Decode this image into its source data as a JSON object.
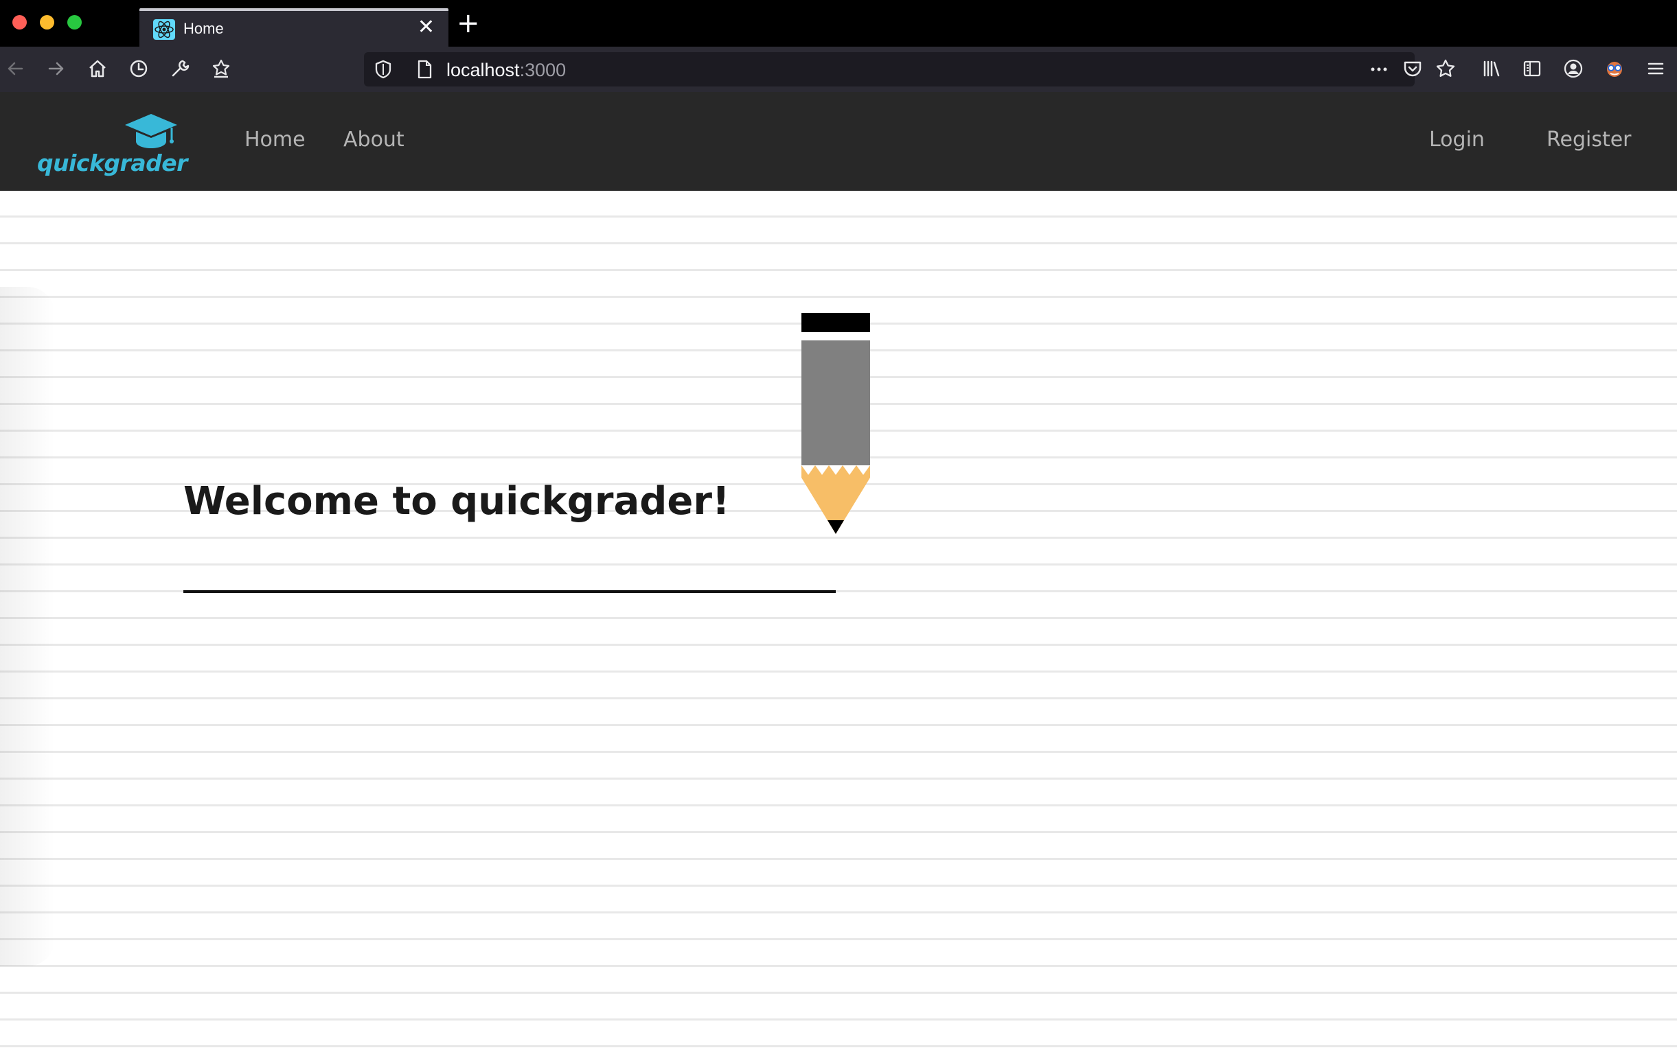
{
  "browser": {
    "tab_title": "Home",
    "tab_close": "✕",
    "new_tab": "+",
    "url_host": "localhost",
    "url_port": ":3000"
  },
  "navbar": {
    "logo_text": "quickgrader",
    "links": {
      "home": "Home",
      "about": "About"
    },
    "auth": {
      "login": "Login",
      "register": "Register"
    },
    "colors": {
      "background": "#282828",
      "accent": "#38b8d8"
    }
  },
  "main": {
    "heading": "Welcome to quickgrader!"
  },
  "colors": {
    "pencil_body": "#808080",
    "pencil_wood": "#f7be67",
    "pencil_eraser": "#000000"
  },
  "icons": [
    "back-icon",
    "forward-icon",
    "home-icon",
    "history-icon",
    "wrench-icon",
    "bookmark-add-icon",
    "shield-icon",
    "page-icon",
    "more-icon",
    "pocket-icon",
    "star-icon",
    "library-icon",
    "sidebar-icon",
    "account-icon",
    "extension-icon",
    "menu-icon",
    "graduation-cap-icon",
    "pencil-icon"
  ]
}
